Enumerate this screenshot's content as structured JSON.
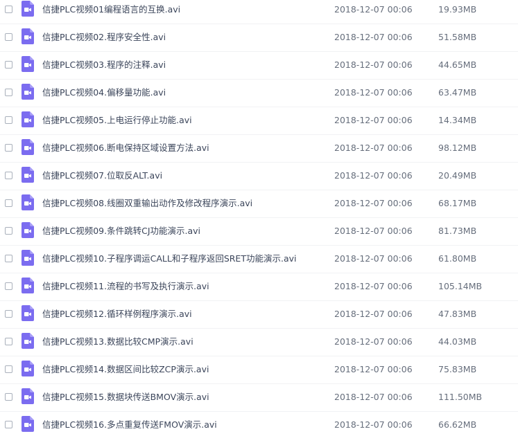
{
  "file_icon": "video-file-icon",
  "icon_color": "#7b6cf0",
  "files": [
    {
      "name": "信捷PLC视频01编程语言的互换.avi",
      "date": "2018-12-07 00:06",
      "size": "19.93MB"
    },
    {
      "name": "信捷PLC视频02.程序安全性.avi",
      "date": "2018-12-07 00:06",
      "size": "51.58MB"
    },
    {
      "name": "信捷PLC视频03.程序的注释.avi",
      "date": "2018-12-07 00:06",
      "size": "44.65MB"
    },
    {
      "name": "信捷PLC视频04.偏移量功能.avi",
      "date": "2018-12-07 00:06",
      "size": "63.47MB"
    },
    {
      "name": "信捷PLC视频05.上电运行停止功能.avi",
      "date": "2018-12-07 00:06",
      "size": "14.34MB"
    },
    {
      "name": "信捷PLC视频06.断电保持区域设置方法.avi",
      "date": "2018-12-07 00:06",
      "size": "98.12MB"
    },
    {
      "name": "信捷PLC视频07.位取反ALT.avi",
      "date": "2018-12-07 00:06",
      "size": "20.49MB"
    },
    {
      "name": "信捷PLC视频08.线圈双重输出动作及修改程序演示.avi",
      "date": "2018-12-07 00:06",
      "size": "68.17MB"
    },
    {
      "name": "信捷PLC视频09.条件跳转CJ功能演示.avi",
      "date": "2018-12-07 00:06",
      "size": "81.73MB"
    },
    {
      "name": "信捷PLC视频10.子程序调运CALL和子程序返回SRET功能演示.avi",
      "date": "2018-12-07 00:06",
      "size": "61.80MB"
    },
    {
      "name": "信捷PLC视频11.流程的书写及执行演示.avi",
      "date": "2018-12-07 00:06",
      "size": "105.14MB"
    },
    {
      "name": "信捷PLC视频12.循环样例程序演示.avi",
      "date": "2018-12-07 00:06",
      "size": "47.83MB"
    },
    {
      "name": "信捷PLC视频13.数据比较CMP演示.avi",
      "date": "2018-12-07 00:06",
      "size": "44.03MB"
    },
    {
      "name": "信捷PLC视频14.数据区间比较ZCP演示.avi",
      "date": "2018-12-07 00:06",
      "size": "75.83MB"
    },
    {
      "name": "信捷PLC视频15.数据块传送BMOV演示.avi",
      "date": "2018-12-07 00:06",
      "size": "111.50MB"
    },
    {
      "name": "信捷PLC视频16.多点重复传送FMOV演示.avi",
      "date": "2018-12-07 00:06",
      "size": "66.62MB"
    }
  ]
}
